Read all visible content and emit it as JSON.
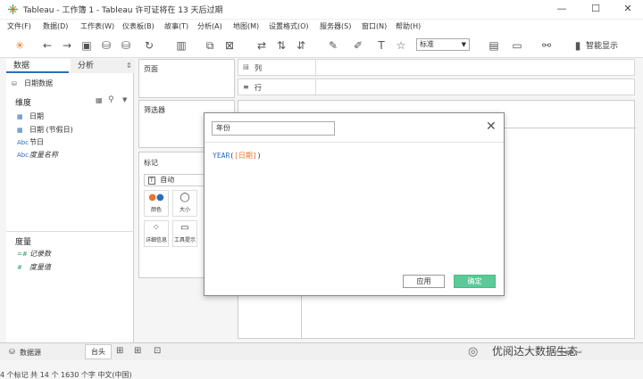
{
  "window": {
    "title": "Tableau - 工作簿 1 - Tableau 许可证将在 13 天后过期"
  },
  "menu": [
    "文件(F)",
    "数据(D)",
    "工作表(W)",
    "仪表板(B)",
    "故事(T)",
    "分析(A)",
    "地图(M)",
    "设置格式(O)",
    "服务器(S)",
    "窗口(N)",
    "帮助(H)"
  ],
  "toolbar": {
    "view_mode": "标准",
    "smart_display": "智能显示"
  },
  "sidebar": {
    "tabs": [
      "数据",
      "分析"
    ],
    "datasource": "日期数据",
    "dimensions_title": "维度",
    "dimensions": [
      {
        "icon": "calendar-icon",
        "type_label": "",
        "name": "日期"
      },
      {
        "icon": "calendar-icon",
        "type_label": "",
        "name": "日期 (节假日)"
      },
      {
        "icon": "string-icon",
        "type_label": "Abc",
        "name": "节日"
      },
      {
        "icon": "string-icon",
        "type_label": "Abc",
        "name": "度量名称"
      }
    ],
    "measures_title": "度量",
    "measures": [
      {
        "icon": "number-icon",
        "type_label": "=#",
        "name": "记录数"
      },
      {
        "icon": "number-icon",
        "type_label": "#",
        "name": "度量值"
      }
    ]
  },
  "panes": {
    "pages": "页面",
    "filters": "筛选器",
    "marks": "标记",
    "marks_type": "自动"
  },
  "marks_cards": [
    {
      "icon": "color-icon",
      "label": "颜色"
    },
    {
      "icon": "size-icon",
      "label": "大小"
    },
    {
      "icon": "detail-icon",
      "label": "详细信息"
    },
    {
      "icon": "tooltip-icon",
      "label": "工具提示"
    }
  ],
  "shelves": {
    "columns": "列",
    "rows": "行"
  },
  "dialog": {
    "name": "年份",
    "formula_func": "YEAR",
    "formula_open": "(",
    "formula_field": "[日期]",
    "formula_close": ")",
    "apply_label": "应用",
    "ok_label": "确定"
  },
  "status": {
    "datasource_tab": "数据源",
    "sheet_tab": "台头",
    "bottom_text": "4 个标记  共 14 个  1630 个字  中文(中国)",
    "watermark": "优阅达大数据生态"
  },
  "colors": {
    "accent_green": "#5cc998",
    "tableau_blue": "#2a6ebb"
  }
}
